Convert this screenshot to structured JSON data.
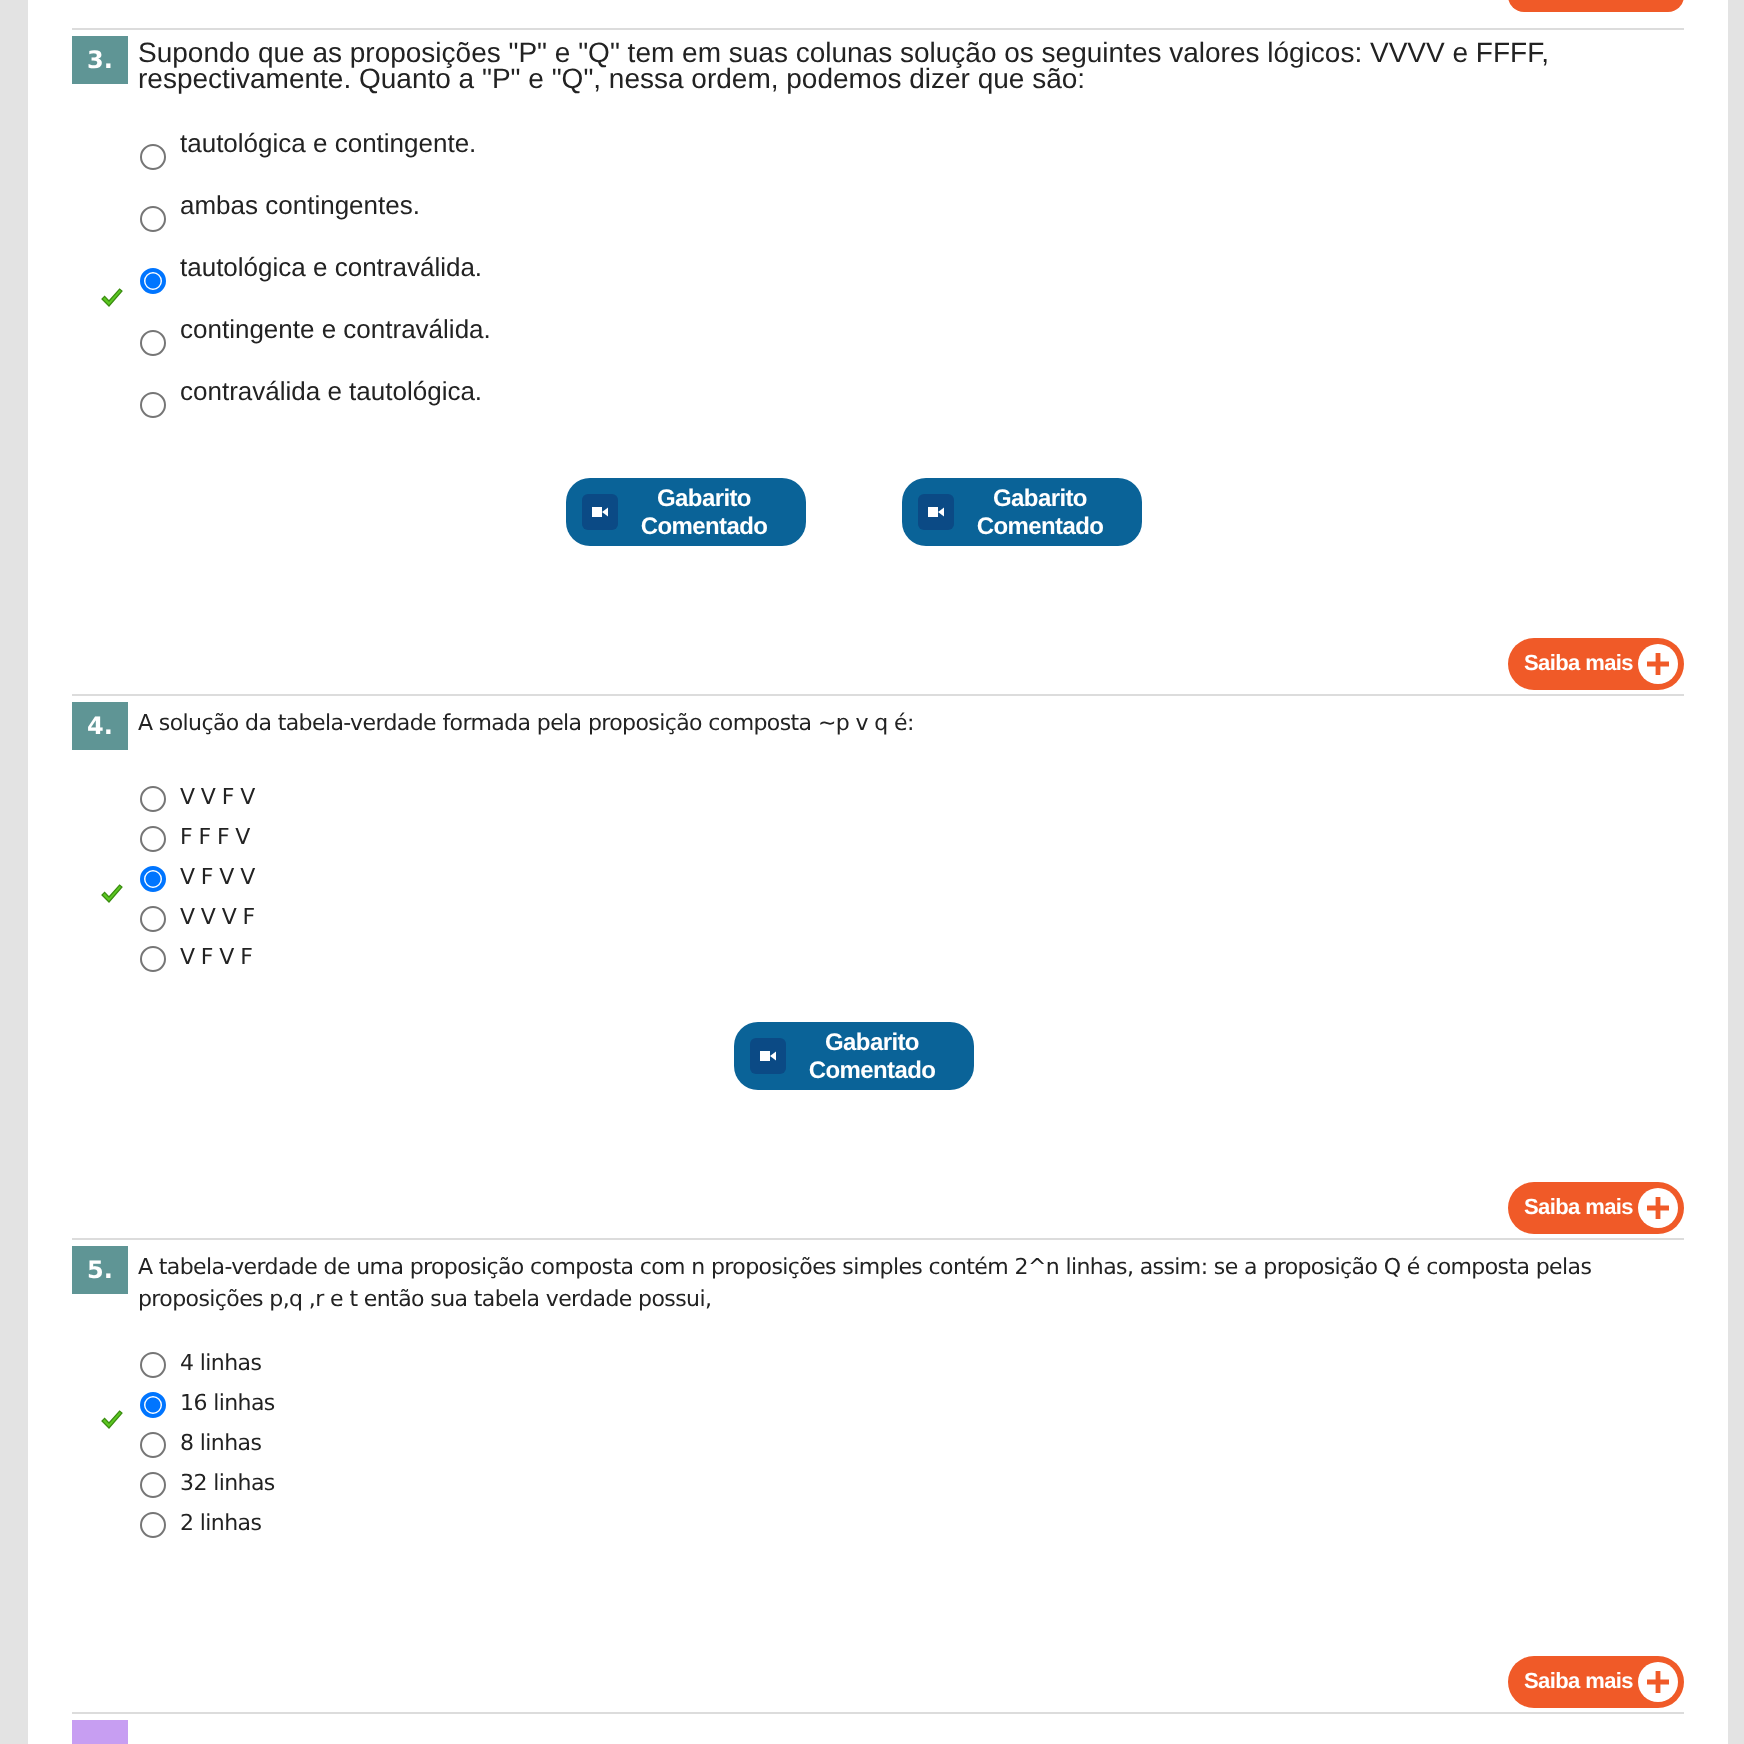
{
  "questions": [
    {
      "number": "3.",
      "kind": "legacy",
      "color": "#5f9595",
      "text": "Supondo que as proposições \"P\" e \"Q\" tem em suas colunas solução os seguintes valores lógicos: VVVV e FFFF, respectivamente. Quanto a \"P\" e \"Q\", nessa ordem, podemos dizer que são:",
      "options": [
        {
          "label": "tautológica e contingente.",
          "selected": false,
          "correct": false
        },
        {
          "label": "ambas contingentes.",
          "selected": false,
          "correct": false
        },
        {
          "label": "tautológica e contraválida.",
          "selected": true,
          "correct": true
        },
        {
          "label": "contingente e contraválida.",
          "selected": false,
          "correct": false
        },
        {
          "label": "contraválida e tautológica.",
          "selected": false,
          "correct": false
        }
      ],
      "buttons": [
        "Gabarito Comentado",
        "Gabarito Comentado"
      ],
      "more_button": "Saiba mais"
    },
    {
      "number": "4.",
      "kind": "modern",
      "color": "#5f9595",
      "text": "A solução da tabela-verdade formada pela proposição composta ~p v q é:",
      "options": [
        {
          "label": "V V F V",
          "selected": false,
          "correct": false
        },
        {
          "label": "F F F V",
          "selected": false,
          "correct": false
        },
        {
          "label": "V F V V",
          "selected": true,
          "correct": true
        },
        {
          "label": "V V V F",
          "selected": false,
          "correct": false
        },
        {
          "label": "V F V F",
          "selected": false,
          "correct": false
        }
      ],
      "buttons": [
        "Gabarito Comentado"
      ],
      "more_button": "Saiba mais"
    },
    {
      "number": "5.",
      "kind": "modern",
      "color": "#5f9595",
      "text": "A tabela-verdade de uma proposição composta com n proposições simples contém 2^n linhas, assim: se a proposição Q é composta pelas proposições p,q ,r e t então sua tabela verdade possui,",
      "options": [
        {
          "label": "4 linhas",
          "selected": false,
          "correct": false
        },
        {
          "label": "16 linhas",
          "selected": true,
          "correct": true
        },
        {
          "label": "8 linhas",
          "selected": false,
          "correct": false
        },
        {
          "label": "32 linhas",
          "selected": false,
          "correct": false
        },
        {
          "label": "2 linhas",
          "selected": false,
          "correct": false
        }
      ],
      "more_button": "Saiba mais"
    },
    {
      "kind": "modern",
      "color": "#c79ef2"
    }
  ]
}
